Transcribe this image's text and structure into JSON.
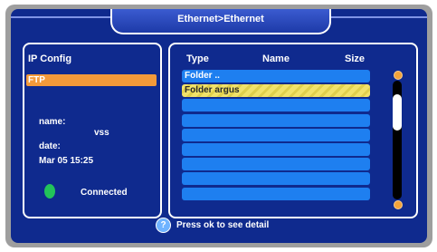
{
  "window": {
    "title": "Ethernet>Ethernet"
  },
  "left_panel": {
    "heading": "IP Config",
    "selected_protocol": "FTP",
    "name_label": "name:",
    "name_value": "vss",
    "date_label": "date:",
    "date_value": "Mar 05 15:25",
    "status_text": "Connected",
    "status_color": "#22c35a"
  },
  "file_list": {
    "headers": {
      "type": "Type",
      "name": "Name",
      "size": "Size"
    },
    "rows": [
      {
        "label": "Folder .."
      },
      {
        "label": "Folder argus",
        "selected": true
      },
      {
        "label": ""
      },
      {
        "label": ""
      },
      {
        "label": ""
      },
      {
        "label": ""
      },
      {
        "label": ""
      },
      {
        "label": ""
      },
      {
        "label": ""
      }
    ]
  },
  "hint": {
    "text": "Press ok to see detail",
    "icon": "question-icon"
  },
  "colors": {
    "screen_bg": "#0f2a8e",
    "row_blue": "#1e7ff0",
    "highlight_orange": "#f39a3a",
    "selection_yellow": "#f1e26a"
  }
}
